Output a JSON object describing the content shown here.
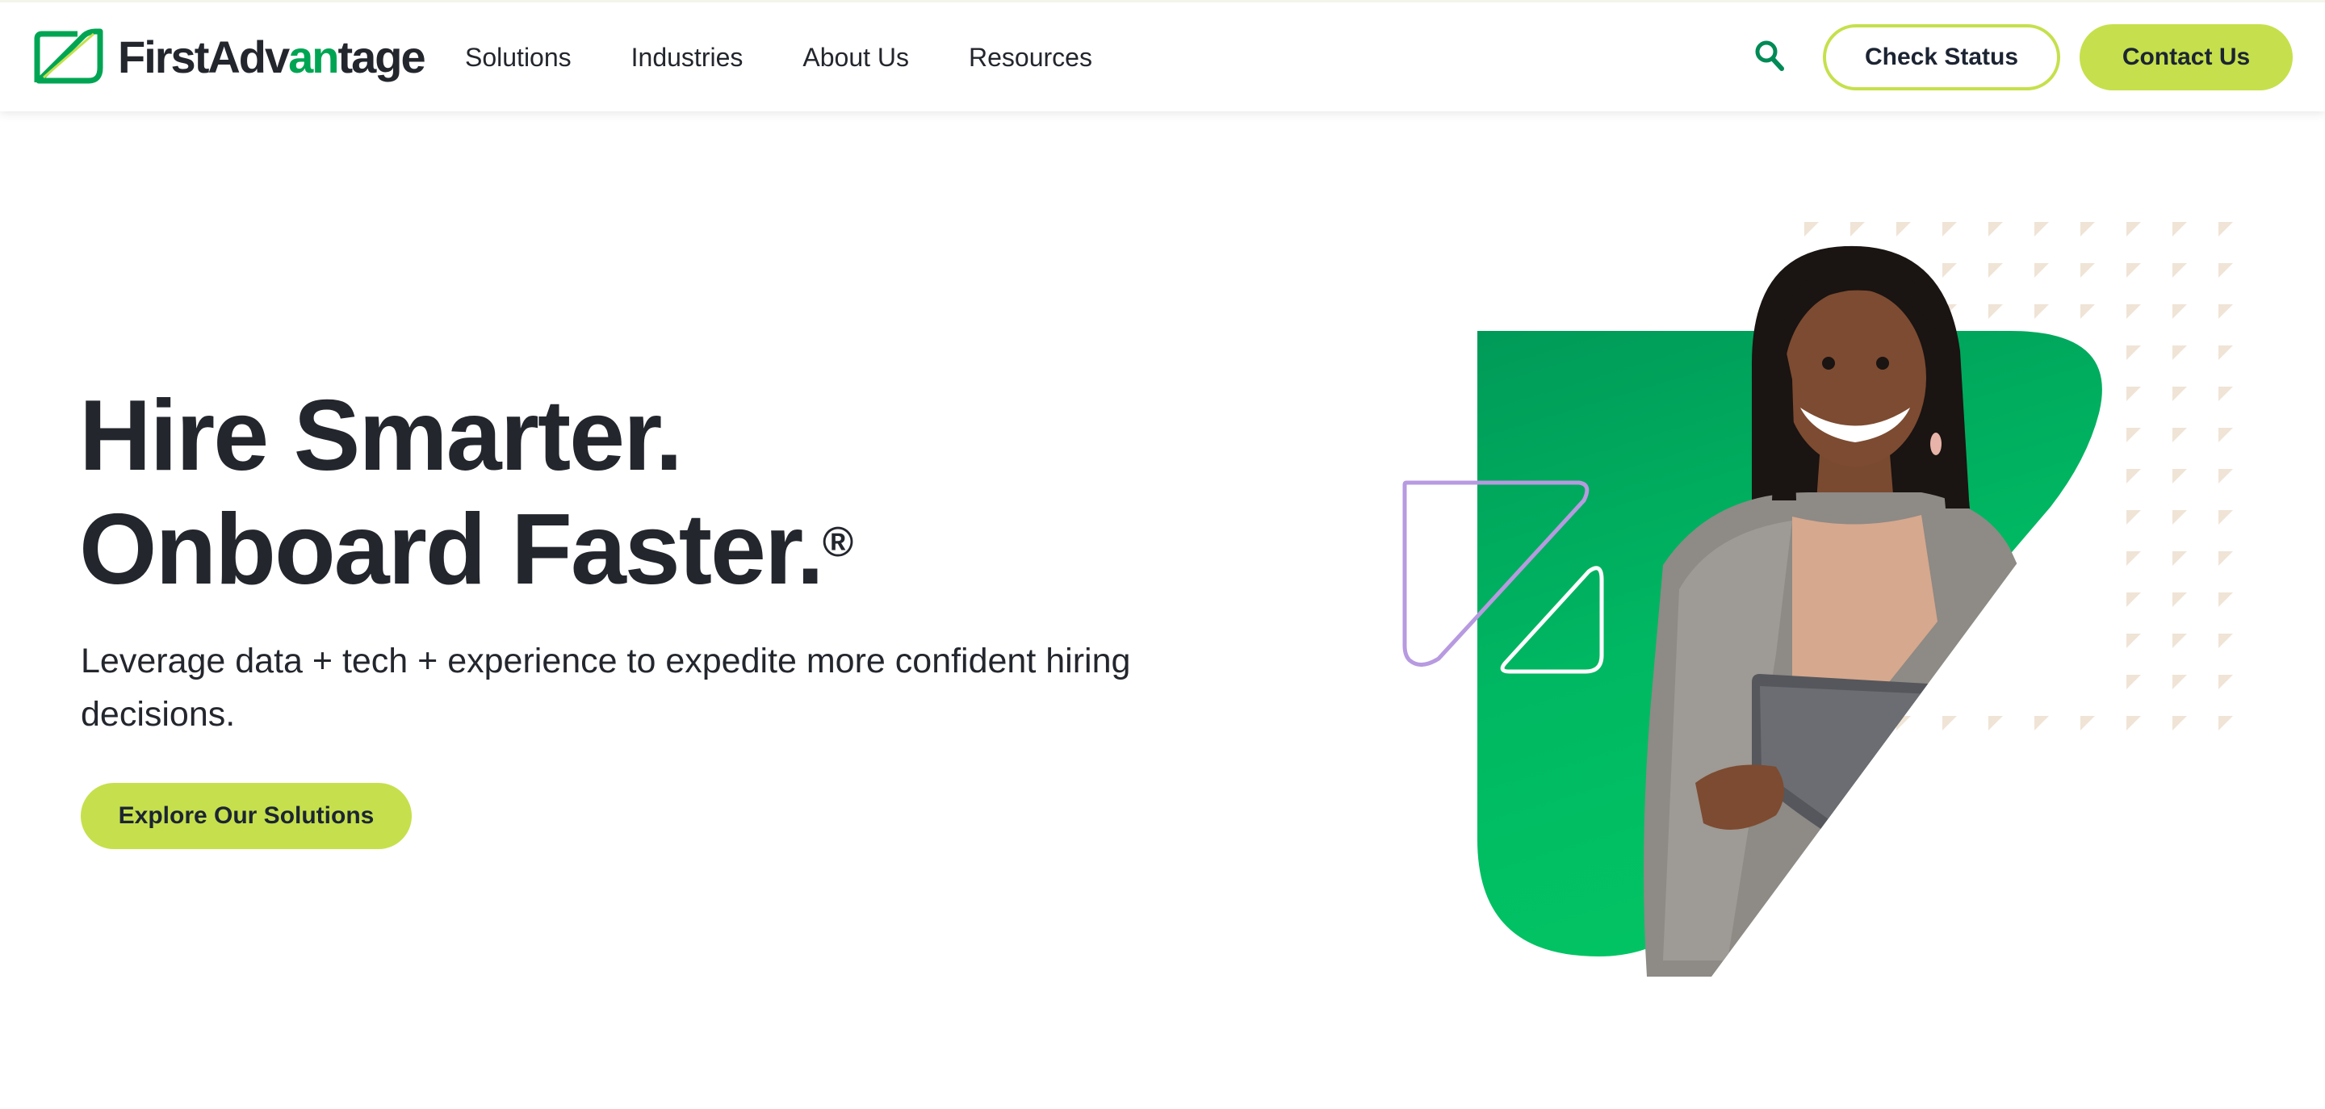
{
  "brand": {
    "name_part1": "First",
    "name_part2": "Adv",
    "name_accent": "an",
    "name_part3": "tage",
    "colors": {
      "primary_green": "#00a553",
      "lime": "#c5e04c",
      "dark_text": "#23262d",
      "lavender": "#b79ae0",
      "dot_beige": "#efe4d6"
    }
  },
  "nav": {
    "items": [
      {
        "label": "Solutions"
      },
      {
        "label": "Industries"
      },
      {
        "label": "About Us"
      },
      {
        "label": "Resources"
      }
    ],
    "search_icon": "search-icon",
    "check_status_label": "Check Status",
    "contact_label": "Contact Us"
  },
  "hero": {
    "title_line1": "Hire Smarter.",
    "title_line2": "Onboard Faster.",
    "registered_mark": "®",
    "subtitle": "Leverage data + tech + experience to expedite more confident hiring decisions.",
    "cta_label": "Explore Our Solutions",
    "image_subject": "smiling-woman-holding-tablet"
  }
}
